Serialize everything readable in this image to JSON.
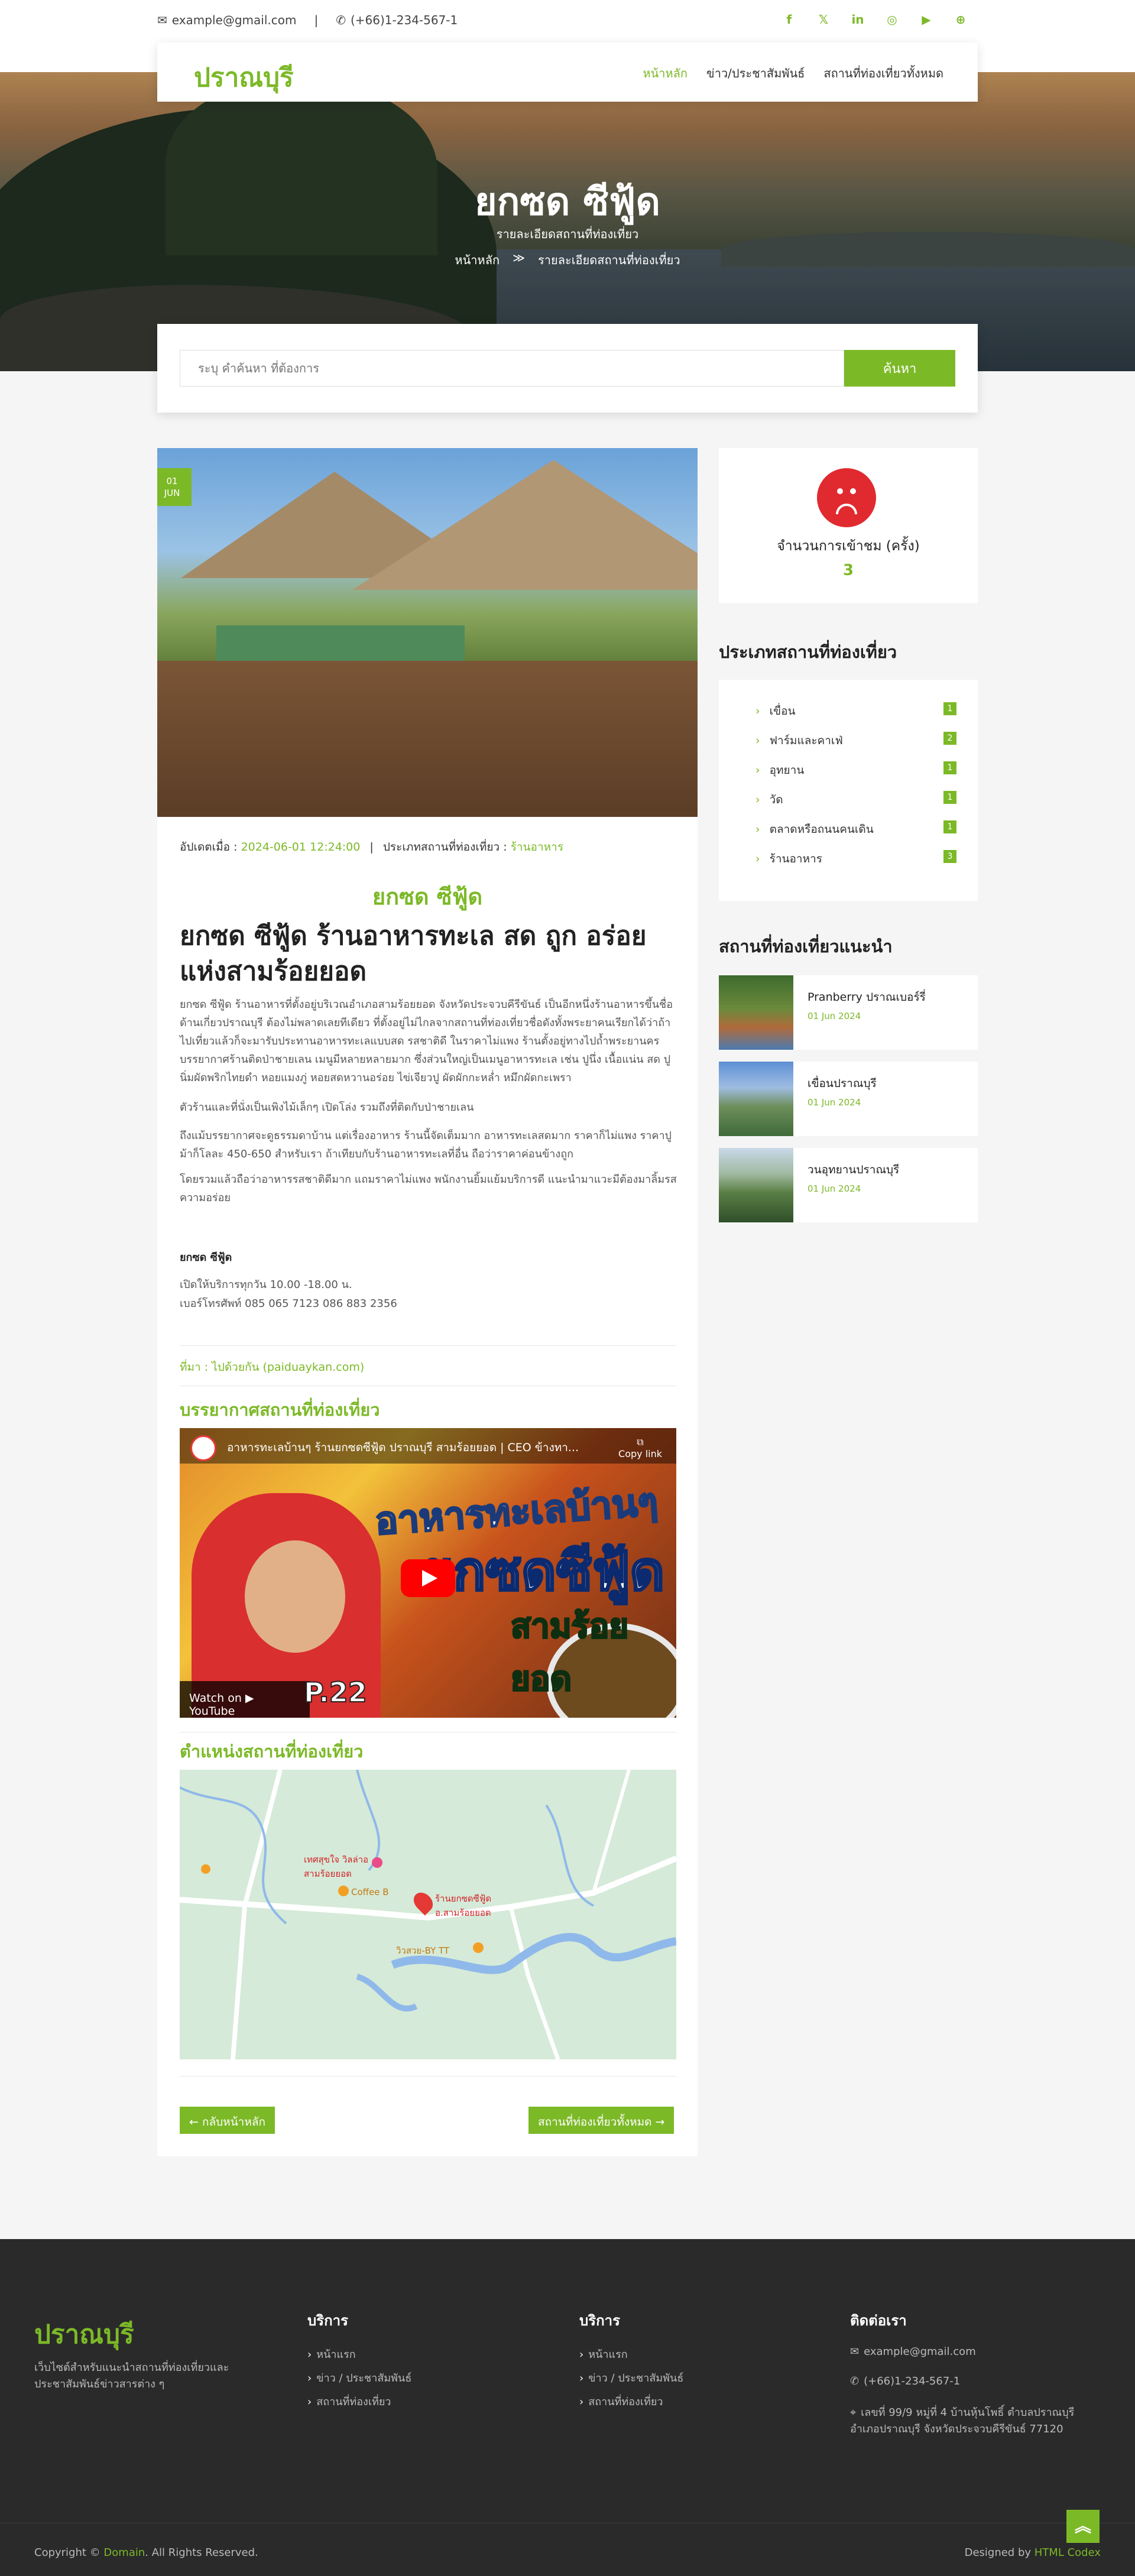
{
  "topbar": {
    "email": "example@gmail.com",
    "phone": "(+66)1-234-567-1",
    "social": [
      "facebook-icon",
      "x-icon",
      "linkedin-icon",
      "instagram-icon",
      "youtube-icon",
      "globe-icon"
    ]
  },
  "nav": {
    "logo": "ปราณบุรี",
    "items": [
      "หน้าหลัก",
      "ข่าว/ประชาสัมพันธ์",
      "สถานที่ท่องเที่ยวทั้งหมด"
    ]
  },
  "hero": {
    "title": "ยกซด ซีฟู้ด",
    "subtitle": "รายละเอียดสถานที่ท่องเที่ยว",
    "crumb_home": "หน้าหลัก",
    "crumb_sep": "≫",
    "crumb_current": "รายละเอียดสถานที่ท่องเที่ยว"
  },
  "search": {
    "placeholder": "ระบุ คำค้นหา ที่ต้องการ",
    "button": "ค้นหา"
  },
  "post": {
    "date_day": "01",
    "date_month": "JUN",
    "updated_label": "อัปเดตเมื่อ :",
    "updated_value": "2024-06-01 12:24:00",
    "category_label": "ประเภทสถานที่ท่องเที่ยว :",
    "category_value": "ร้านอาหาร",
    "short_title": "ยกซด ซีฟู้ด",
    "long_title": "ยกซด ซีฟู้ด ร้านอาหารทะเล สด ถูก อร่อย แห่งสามร้อยยอด",
    "p1": "ยกซด ซีฟู้ด ร้านอาหารที่ตั้งอยู่บริเวณอำเภอสามร้อยยอด จังหวัดประจวบคีรีขันธ์ เป็นอีกหนึ่งร้านอาหารขึ้นชื่อด้านเกี่ยวปราณบุรี ต้องไม่พลาดเลยทีเดียว ที่ตั้งอยู่ไม่ไกลจากสถานที่ท่องเที่ยวชื่อดังทั้งพระยาคนเรียกได้ว่าถ้าไปเที่ยวแล้วก็จะมารับประทานอาหารทะเลแบบสด รสชาติดี ในราคาไม่แพง ร้านตั้งอยู่ทางไปถ้ำพระยานคร บรรยากาศร้านติดป่าชายเลน เมนูมีหลายหลายมาก ซึ่งส่วนใหญ่เป็นเมนูอาหารทะเล เช่น ปูนึ่ง เนื้อแน่น สด ปูนิ่มผัดพริกไทยดำ หอยแมงภู่ หอยสดหวานอร่อย ไข่เจียวปู ผัดผักกะหล่ำ หมึกผัดกะเพรา",
    "p2": "ตัวร้านและที่นั่งเป็นเพิงไม้เล็กๆ เปิดโล่ง รวมถึงที่ติดกับป่าชายเลน",
    "p3": "ถึงแม้บรรยากาศจะดูธรรมดาบ้าน แต่เรื่องอาหาร ร้านนี้จัดเต็มมาก อาหารทะเลสดมาก ราคาก็ไม่แพง ราคาปูม้าก็โลละ 450-650 สำหรับเรา ถ้าเทียบกับร้านอาหารทะเลที่อื่น ถือว่าราคาค่อนข้างถูก",
    "p4": "โดยรวมแล้วถือว่าอาหารรสชาติดีมาก แถมราคาไม่แพง พนักงานยิ้มแย้มบริการดี แนะนำมาแวะมีต้องมาลิ้มรสความอร่อย",
    "contact_name": "ยกซด ซีฟู้ด",
    "contact_hours": "เปิดให้บริการทุกวัน 10.00 -18.00 น.",
    "contact_phone": "เบอร์โทรศัพท์ 085 065 7123 086 883 2356",
    "source": "ที่มา : ไปด้วยกัน (paiduaykan.com)",
    "video_section": "บรรยากาศสถานที่ท่องเที่ยว",
    "video_title": "อาหารทะเลบ้านๆ ร้านยกซดซีฟู้ด ปราณบุรี สามร้อยยอด | CEO ข้างทา...",
    "video_copy": "Copy link",
    "video_big1": "อาหารทะเลบ้านๆ",
    "video_big2": "ยกซดซีฟู้ด",
    "video_big3": "สามร้อยยอด",
    "video_watch": "Watch on ▶ YouTube",
    "video_ep": "P.22",
    "map_section": "ตำแหน่งสถานที่ท่องเที่ยว",
    "map_label1": "เทศสุขใจ วิลล่าอ สามร้อยยอด",
    "map_label2": "Coffee B",
    "map_label3": "ร้านยกซดซีฟู้ด อ.สามร้อยยอด",
    "map_label4": "วิวสวย-BY TT",
    "back_button": "← กลับหน้าหลัก",
    "all_button": "สถานที่ท่องเที่ยวทั้งหมด →"
  },
  "sidebar": {
    "visits_label": "จำนวนการเข้าชม (ครั้ง)",
    "visits_value": "3",
    "types_title": "ประเภทสถานที่ท่องเที่ยว",
    "types": [
      {
        "label": "เขื่อน",
        "count": "1"
      },
      {
        "label": "ฟาร์มและคาเฟ่",
        "count": "2"
      },
      {
        "label": "อุทยาน",
        "count": "1"
      },
      {
        "label": "วัด",
        "count": "1"
      },
      {
        "label": "ตลาดหรือถนนคนเดิน",
        "count": "1"
      },
      {
        "label": "ร้านอาหาร",
        "count": "3"
      }
    ],
    "recommended_title": "สถานที่ท่องเที่ยวแนะนำ",
    "recommended": [
      {
        "title": "Pranberry ปราณเบอร์รี่",
        "date": "01 Jun 2024"
      },
      {
        "title": "เขื่อนปราณบุรี",
        "date": "01 Jun 2024"
      },
      {
        "title": "วนอุทยานปราณบุรี",
        "date": "01 Jun 2024"
      }
    ]
  },
  "footer": {
    "logo": "ปราณบุรี",
    "desc": "เว็บไซต์สำหรับแนะนำสถานที่ท่องเที่ยวและประชาสัมพันธ์ข่าวสารต่าง ๆ",
    "col1_title": "บริการ",
    "col1_items": [
      "หน้าแรก",
      "ข่าว / ประชาสัมพันธ์",
      "สถานที่ท่องเที่ยว"
    ],
    "col2_title": "บริการ",
    "col2_items": [
      "หน้าแรก",
      "ข่าว / ประชาสัมพันธ์",
      "สถานที่ท่องเที่ยว"
    ],
    "contact_title": "ติดต่อเรา",
    "contact_email": "example@gmail.com",
    "contact_phone": "(+66)1-234-567-1",
    "contact_address": "เลขที่ 99/9 หมู่ที่ 4 บ้านหุ้นโพธิ์ ตำบลปราณบุรี อำเภอปราณบุรี จังหวัดประจวบคีรีขันธ์ 77120",
    "copyright_prefix": "Copyright ©",
    "copyright_domain": "Domain",
    "copyright_suffix": ". All Rights Reserved.",
    "designed_prefix": "Designed by",
    "designed_by": "HTML Codex"
  },
  "colors": {
    "accent": "#7cb927",
    "footer_bg": "#2a2a2a",
    "sad_red": "#e02a30"
  }
}
